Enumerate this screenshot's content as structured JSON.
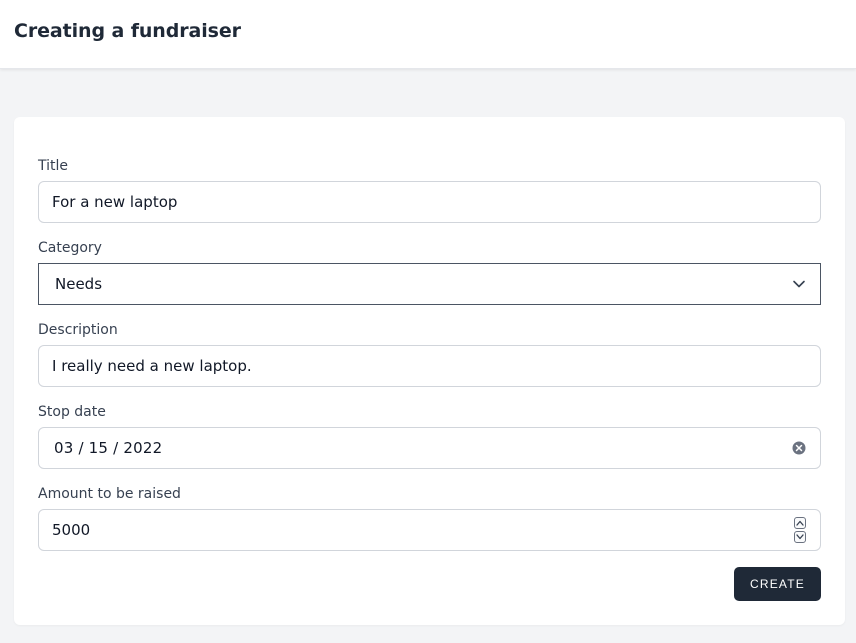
{
  "header": {
    "title": "Creating a fundraiser"
  },
  "form": {
    "title_label": "Title",
    "title_value": "For a new laptop",
    "category_label": "Category",
    "category_value": "Needs",
    "description_label": "Description",
    "description_value": "I really need a new laptop.",
    "stop_date_label": "Stop date",
    "stop_date_value": "03 / 15 / 2022",
    "amount_label": "Amount to be raised",
    "amount_value": "5000",
    "submit_label": "CREATE"
  },
  "icons": {
    "category_dropdown": "chevron-down-icon",
    "date_clear": "clear-icon",
    "amount_spinner": "spinner-arrows-icon"
  },
  "colors": {
    "header_bg": "#ffffff",
    "page_bg": "#f3f4f6",
    "button_bg": "#1f2937",
    "button_text": "#ffffff"
  }
}
